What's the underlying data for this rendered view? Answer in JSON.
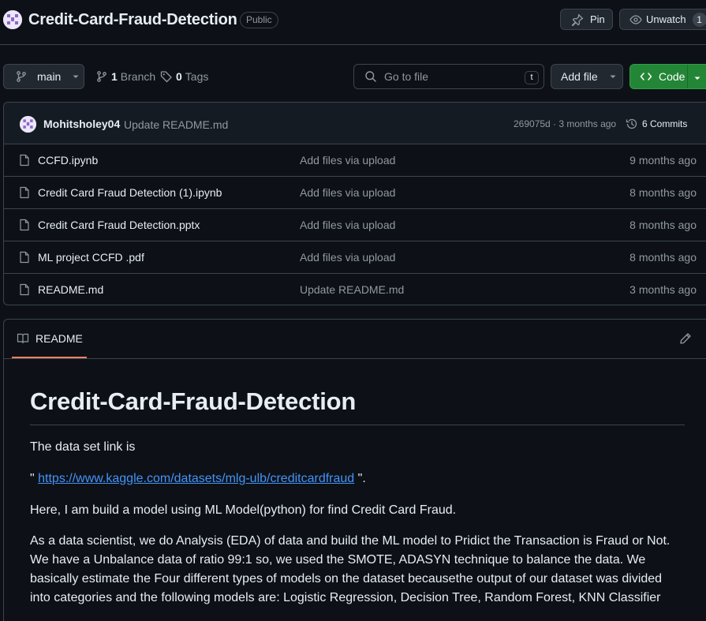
{
  "header": {
    "repo_name": "Credit-Card-Fraud-Detection",
    "visibility": "Public",
    "pin_label": "Pin",
    "watch_label": "Unwatch",
    "watch_count": "1"
  },
  "toolbar": {
    "branch": "main",
    "branch_count": "1",
    "branch_label": "Branch",
    "tag_count": "0",
    "tag_label": "Tags",
    "search_placeholder": "Go to file",
    "search_shortcut": "t",
    "add_file_label": "Add file",
    "code_label": "Code"
  },
  "latest_commit": {
    "author": "Mohitsholey04",
    "message": "Update README.md",
    "sha_time": "269075d · 3 months ago",
    "commits_label": "6 Commits"
  },
  "files": [
    {
      "name": "CCFD.ipynb",
      "message": "Add files via upload",
      "time": "9 months ago"
    },
    {
      "name": "Credit Card Fraud Detection (1).ipynb",
      "message": "Add files via upload",
      "time": "8 months ago"
    },
    {
      "name": "Credit Card Fraud Detection.pptx",
      "message": "Add files via upload",
      "time": "8 months ago"
    },
    {
      "name": "ML project CCFD .pdf",
      "message": "Add files via upload",
      "time": "8 months ago"
    },
    {
      "name": "README.md",
      "message": "Update README.md",
      "time": "3 months ago"
    }
  ],
  "readme": {
    "tab_label": "README",
    "title": "Credit-Card-Fraud-Detection",
    "p1": "The data set link is",
    "p2_prefix": "\" ",
    "p2_link": "https://www.kaggle.com/datasets/mlg-ulb/creditcardfraud",
    "p2_suffix": " \".",
    "p3": "Here, I am build a model using ML Model(python) for find Credit Card Fraud.",
    "p4": "As a data scientist, we do Analysis (EDA) of data and build the ML model to Pridict the Transaction is Fraud or Not. We have a Unbalance data of ratio 99:1 so, we used the SMOTE, ADASYN technique to balance the data. We basically estimate the Four different types of models on the dataset becausethe output of our dataset was divided into categories and the following models are: Logistic Regression, Decision Tree, Random Forest, KNN Classifier"
  },
  "colors": {
    "background": "#0d1117",
    "border": "#3d444d",
    "accent_green": "#238636",
    "link": "#4493f8",
    "tab_underline": "#f78166"
  }
}
